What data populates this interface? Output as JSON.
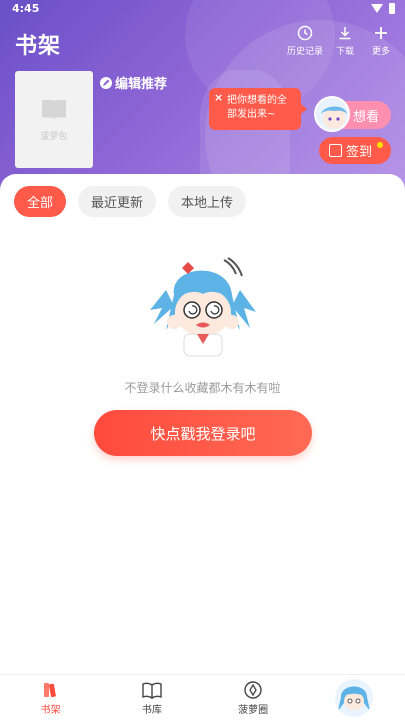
{
  "status_bar": {
    "time": "4:45"
  },
  "header": {
    "title": "书架",
    "actions": [
      {
        "label": "历史记录",
        "icon": "clock-icon"
      },
      {
        "label": "下载",
        "icon": "download-icon"
      },
      {
        "label": "更多",
        "icon": "plus-icon"
      }
    ],
    "recommend_label": "编辑推荐",
    "cover_placeholder_brand": "菠萝包",
    "bubble_text": "把你想看的全部发出来~",
    "bubble_close": "×",
    "want_label": "想看",
    "checkin_label": "签到"
  },
  "tabs": [
    {
      "label": "全部",
      "active": true
    },
    {
      "label": "最近更新",
      "active": false
    },
    {
      "label": "本地上传",
      "active": false
    }
  ],
  "empty_state": {
    "message": "不登录什么收藏都木有木有啦",
    "login_button": "快点戳我登录吧"
  },
  "bottom_nav": [
    {
      "label": "书架",
      "icon": "bookshelf-icon",
      "active": true
    },
    {
      "label": "书库",
      "icon": "open-book-icon",
      "active": false
    },
    {
      "label": "菠萝圈",
      "icon": "compass-icon",
      "active": false
    },
    {
      "label": "",
      "icon": "avatar",
      "active": false
    }
  ],
  "colors": {
    "accent": "#ff5a4a",
    "header_start": "#6a4fc7",
    "header_end": "#b08ae6"
  }
}
